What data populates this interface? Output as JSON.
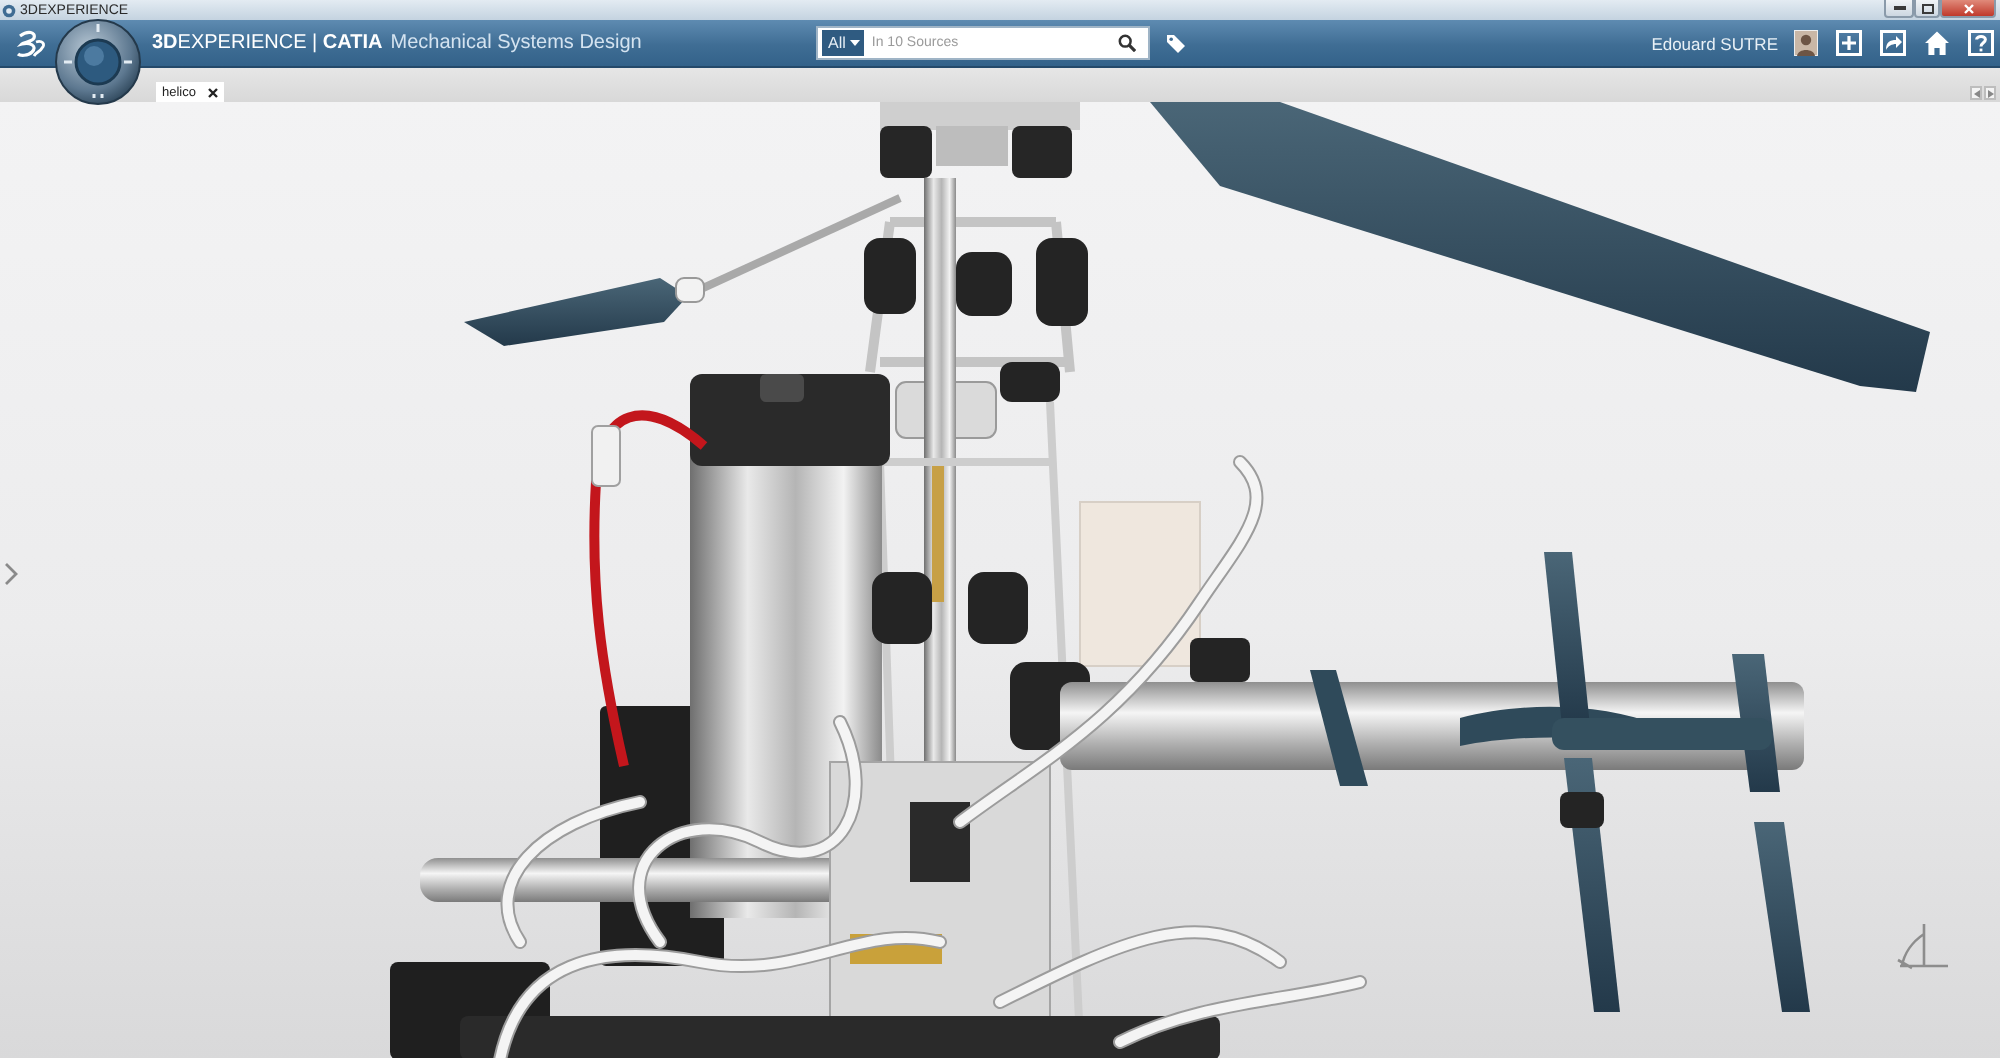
{
  "window": {
    "title": "3DEXPERIENCE"
  },
  "top_bar": {
    "brand": "**3D**EXPERIENCE | **CATIA**",
    "app_name": "Mechanical Systems Design",
    "search": {
      "scope": "All",
      "placeholder": "In 10 Sources"
    },
    "user": {
      "name": "Edouard SUTRE"
    }
  },
  "tabs": [
    {
      "label": "helico",
      "selected": true
    }
  ]
}
